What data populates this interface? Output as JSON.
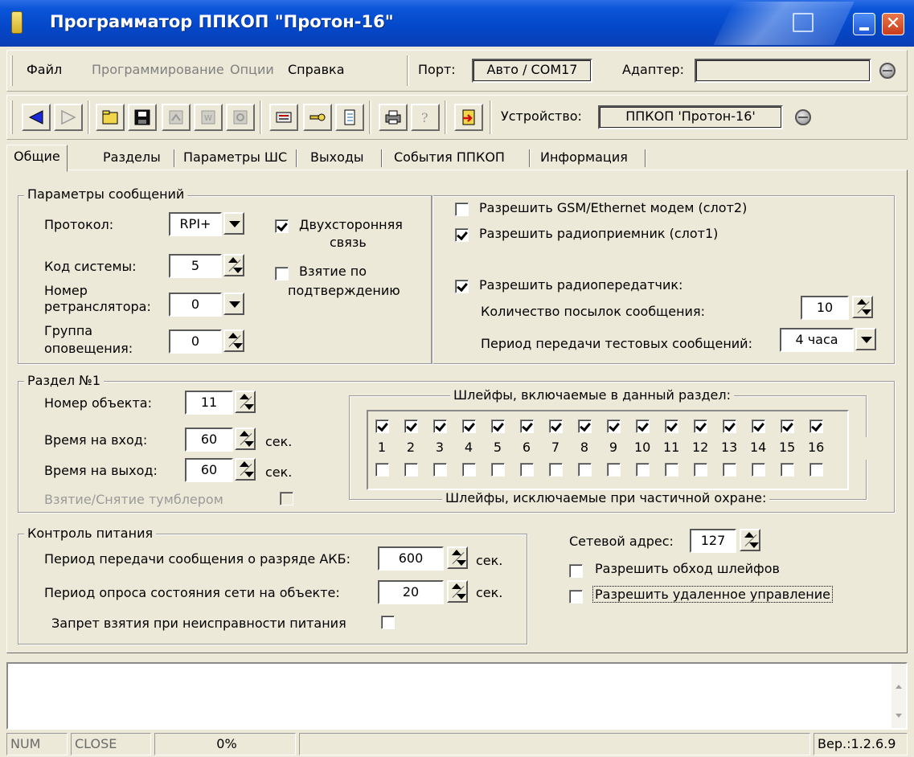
{
  "window": {
    "title": "Программатор ППКОП \"Протон-16\""
  },
  "menu": {
    "items": [
      {
        "label": "Файл",
        "enabled": true
      },
      {
        "label": "Программирование",
        "enabled": false
      },
      {
        "label": "Опции",
        "enabled": false
      },
      {
        "label": "Справка",
        "enabled": true
      }
    ],
    "port_label": "Порт:",
    "port_value": "Авто / COM17",
    "adapter_label": "Адаптер:",
    "adapter_value": ""
  },
  "toolbar": {
    "buttons": [
      "back-icon",
      "forward-icon",
      "open-folder-icon",
      "save-icon",
      "read-icon",
      "write-icon",
      "verify-icon",
      "keyboard-icon",
      "key-icon",
      "document-icon",
      "print-icon",
      "help-icon",
      "exit-icon"
    ],
    "device_label": "Устройство:",
    "device_value": "ППКОП 'Протон-16'"
  },
  "tabs": [
    "Общие",
    "Разделы",
    "Параметры ШС",
    "Выходы",
    "События ППКОП",
    "Информация"
  ],
  "messages": {
    "title": "Параметры сообщений",
    "protocol_label": "Протокол:",
    "protocol_value": "RPI+",
    "system_code_label": "Код системы:",
    "system_code_value": "5",
    "repeater_label_1": "Номер",
    "repeater_label_2": "ретранслятора:",
    "repeater_value": "0",
    "group_label_1": "Группа",
    "group_label_2": "оповещения:",
    "group_value": "0",
    "two_way_1": "Двухсторонняя",
    "two_way_2": "связь",
    "two_way_checked": true,
    "arm_confirm_1": "Взятие по",
    "arm_confirm_2": "подтверждению",
    "arm_confirm_checked": false,
    "gsm_label": "Разрешить GSM/Ethernet модем (слот2)",
    "gsm_checked": false,
    "radio_rx_label": "Разрешить радиоприемник (слот1)",
    "radio_rx_checked": true,
    "radio_tx_label": "Разрешить радиопередатчик:",
    "radio_tx_checked": true,
    "packets_label": "Количество посылок сообщения:",
    "packets_value": "10",
    "test_period_label": "Период передачи тестовых сообщений:",
    "test_period_value": "4 часа"
  },
  "section": {
    "title": "Раздел №1",
    "object_label": "Номер объекта:",
    "object_value": "11",
    "entry_label": "Время на вход:",
    "entry_value": "60",
    "exit_label": "Время на выход:",
    "exit_value": "60",
    "sec": "сек.",
    "toggle_label": "Взятие/Снятие тумблером",
    "included_title": "Шлейфы, включаемые в данный раздел:",
    "excluded_title": "Шлейфы, исключаемые при частичной охране:",
    "loop_numbers": [
      "1",
      "2",
      "3",
      "4",
      "5",
      "6",
      "7",
      "8",
      "9",
      "10",
      "11",
      "12",
      "13",
      "14",
      "15",
      "16"
    ]
  },
  "power": {
    "title": "Контроль питания",
    "battery_label": "Период передачи сообщения о разряде АКБ:",
    "battery_value": "600",
    "mains_label": "Период опроса состояния сети на объекте:",
    "mains_value": "20",
    "sec": "сек.",
    "block_label": "Запрет взятия при неисправности питания"
  },
  "network": {
    "address_label": "Сетевой адрес:",
    "address_value": "127",
    "bypass_label": "Разрешить обход шлейфов",
    "remote_label": "Разрешить удаленное управление"
  },
  "status": {
    "num": "NUM",
    "close": "CLOSE",
    "progress": "0%",
    "version": "Вер.:1.2.6.9"
  },
  "colors": {
    "title_bar": "#0a54d8",
    "face": "#ece9d8"
  }
}
